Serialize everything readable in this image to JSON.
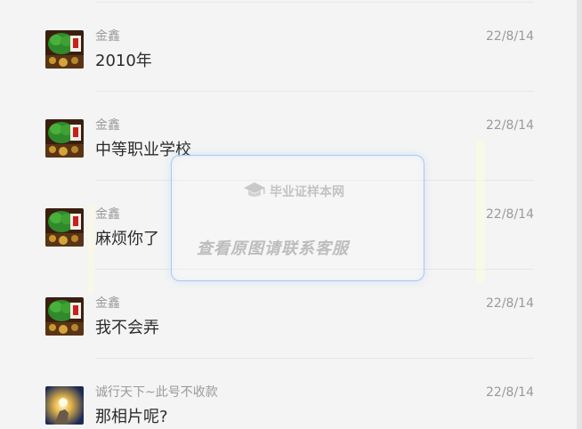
{
  "messages": [
    {
      "name": "金鑫",
      "date": "22/8/14",
      "text": "2010年",
      "avatar": "money-tree-avatar"
    },
    {
      "name": "金鑫",
      "date": "22/8/14",
      "text": "中等职业学校",
      "avatar": "money-tree-avatar"
    },
    {
      "name": "金鑫",
      "date": "22/8/14",
      "text": "麻烦你了",
      "avatar": "money-tree-avatar"
    },
    {
      "name": "金鑫",
      "date": "22/8/14",
      "text": "我不会弄",
      "avatar": "money-tree-avatar"
    },
    {
      "name": "诚行天下~此号不收款",
      "date": "22/8/14",
      "text": "那相片呢?",
      "avatar": "glowing-hand-avatar"
    }
  ],
  "watermark": {
    "brand": "毕业证样本网",
    "notice": "查看原图请联系客服",
    "icon": "graduation-cap-icon"
  },
  "colors": {
    "background": "#f4f4f4",
    "name_gray": "#9a9a9a",
    "text_dark": "#2b2b2b",
    "divider": "#e6e6e6",
    "watermark_border": "#a9c9ee"
  }
}
